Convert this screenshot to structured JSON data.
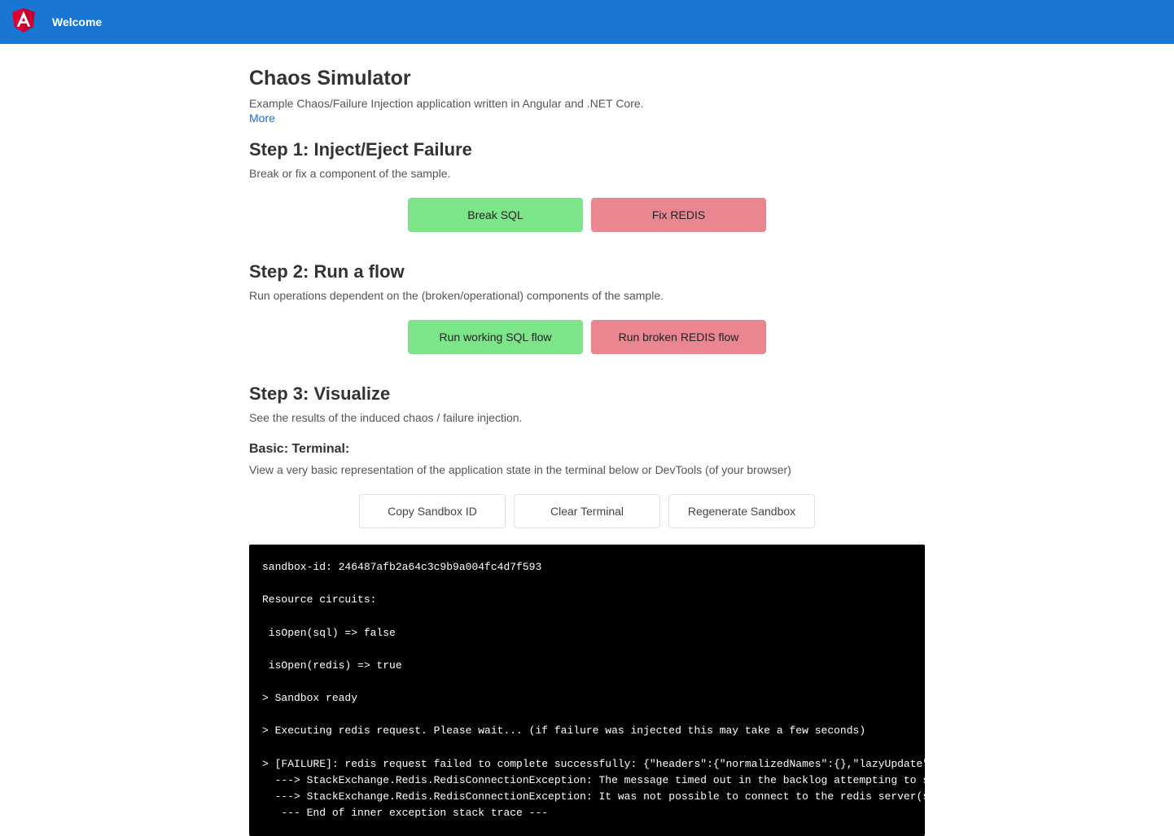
{
  "header": {
    "title": "Welcome"
  },
  "page": {
    "title": "Chaos Simulator",
    "subtitle": "Example Chaos/Failure Injection application written in Angular and .NET Core.",
    "more_link": "More"
  },
  "step1": {
    "heading": "Step 1: Inject/Eject Failure",
    "desc": "Break or fix a component of the sample.",
    "btn_break": "Break SQL",
    "btn_fix": "Fix REDIS"
  },
  "step2": {
    "heading": "Step 2: Run a flow",
    "desc": "Run operations dependent on the (broken/operational) components of the sample.",
    "btn_break": "Run working SQL flow",
    "btn_fix": "Run broken REDIS flow"
  },
  "step3": {
    "heading": "Step 3: Visualize",
    "desc": "See the results of the induced chaos / failure injection."
  },
  "terminal_section": {
    "heading": "Basic: Terminal:",
    "desc": "View a very basic representation of the application state in the terminal below or DevTools (of your browser)",
    "btn_copy": "Copy Sandbox ID",
    "btn_clear": "Clear Terminal",
    "btn_regen": "Regenerate Sandbox"
  },
  "terminal_output": "sandbox-id: 246487afb2a64c3c9b9a004fc4d7f593\n\nResource circuits:\n\n isOpen(sql) => false\n\n isOpen(redis) => true\n\n> Sandbox ready\n\n> Executing redis request. Please wait... (if failure was injected this may take a few seconds)\n\n> [FAILURE]: redis request failed to complete successfully: {\"headers\":{\"normalizedNames\":{},\"lazyUpdate\":null},\"st\n  ---> StackExchange.Redis.RedisConnectionException: The message timed out in the backlog attempting to send because\n  ---> StackExchange.Redis.RedisConnectionException: It was not possible to connect to the redis server(s). ConnectT\n   --- End of inner exception stack trace ---"
}
